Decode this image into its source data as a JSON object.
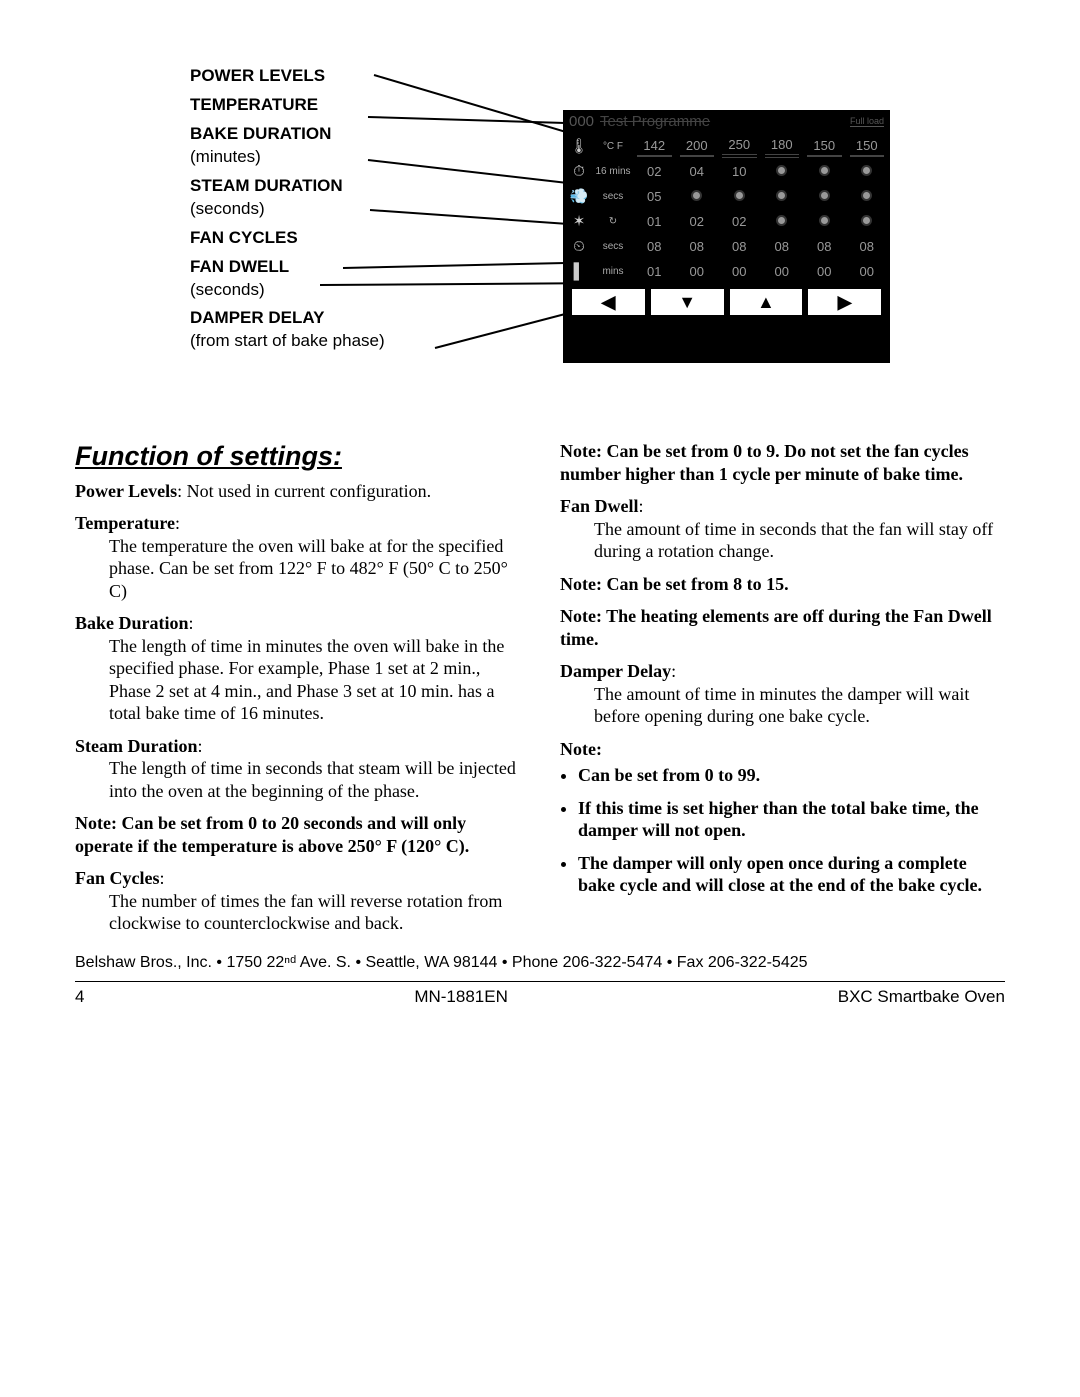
{
  "diagram": {
    "labels": [
      {
        "bold": "POWER LEVELS",
        "sub": ""
      },
      {
        "bold": "TEMPERATURE",
        "sub": ""
      },
      {
        "bold": "BAKE DURATION",
        "sub": "(minutes)"
      },
      {
        "bold": "STEAM DURATION",
        "sub": "(seconds)"
      },
      {
        "bold": "FAN CYCLES",
        "sub": ""
      },
      {
        "bold": "FAN DWELL",
        "sub": "(seconds)"
      },
      {
        "bold": "DAMPER DELAY",
        "sub": "(from start of bake phase)"
      }
    ],
    "panel": {
      "prog_num": "000",
      "prog_name": "Test Programme",
      "full": "Full load",
      "rows": {
        "temp": {
          "icon": "🌡",
          "unit": "°C F",
          "vals": [
            "142",
            "200",
            "250",
            "180",
            "150",
            "150"
          ],
          "underline": true
        },
        "bake": {
          "icon": "⏱",
          "unit": "16 mins",
          "vals": [
            "02",
            "04",
            "10",
            "•",
            "•",
            "•"
          ]
        },
        "steam": {
          "icon": "💨",
          "unit": "secs",
          "vals": [
            "05",
            "•",
            "•",
            "•",
            "•",
            "•"
          ]
        },
        "fanc": {
          "icon": "✶",
          "unit": "↻",
          "vals": [
            "01",
            "02",
            "02",
            "•",
            "•",
            "•"
          ]
        },
        "fand": {
          "icon": "⏲",
          "unit": "secs",
          "vals": [
            "08",
            "08",
            "08",
            "08",
            "08",
            "08"
          ]
        },
        "damp": {
          "icon": "▌",
          "unit": "mins",
          "vals": [
            "01",
            "00",
            "00",
            "00",
            "00",
            "00"
          ]
        }
      },
      "buttons": [
        "◀",
        "▼",
        "▲",
        "▶"
      ]
    }
  },
  "section_title": "Function of settings:",
  "defs": [
    {
      "term": "Power Levels",
      "body": "Not used in current configuration."
    },
    {
      "term": "Temperature",
      "body": "The temperature the oven will bake at for the specified phase.  Can be set from 122° F to 482° F (50° C to 250° C)"
    },
    {
      "term": "Bake Duration",
      "body": "The length of time in minutes the oven will bake in the specified phase.  For example, Phase 1 set at 2 min., Phase 2 set at 4 min., and Phase 3 set at 10 min. has a total bake time of 16 minutes."
    },
    {
      "term": "Steam Duration",
      "body": "The length of time in seconds that steam will be injected into the oven at the beginning of the phase."
    }
  ],
  "note1": "Note:  Can be set from 0 to 20 seconds and will only operate if the temperature is above 250° F (120° C).",
  "defs2": [
    {
      "term": "Fan Cycles",
      "body": "The number of times the fan will reverse rotation from clockwise to counterclockwise and back."
    }
  ],
  "note2": "Note:  Can be set from 0 to 9.  Do not set the fan cycles number higher than 1 cycle per minute of bake time.",
  "defs3": [
    {
      "term": "Fan Dwell",
      "body": "The amount of time in seconds that the fan will stay off during a rotation change."
    }
  ],
  "note3": "Note:  Can be set from 8 to 15.",
  "note4": "Note:  The heating elements are off during the Fan Dwell time.",
  "defs4": [
    {
      "term": "Damper Delay",
      "body": "The amount of time in minutes the damper will wait before opening during one bake cycle."
    }
  ],
  "note5_head": "Note:",
  "note5_items": [
    "Can be set from 0 to 99.",
    "If this time is set higher than the total bake time, the damper will not open.",
    "The damper will only open once during a complete bake cycle and will close at the end of the bake cycle."
  ],
  "footer_addr": "Belshaw Bros., Inc. • 1750 22ⁿᵈ Ave. S. • Seattle, WA 98144 • Phone 206-322-5474 • Fax 206-322-5425",
  "footer_left": "4",
  "footer_center": "MN-1881EN",
  "footer_right": "BXC Smartbake Oven"
}
